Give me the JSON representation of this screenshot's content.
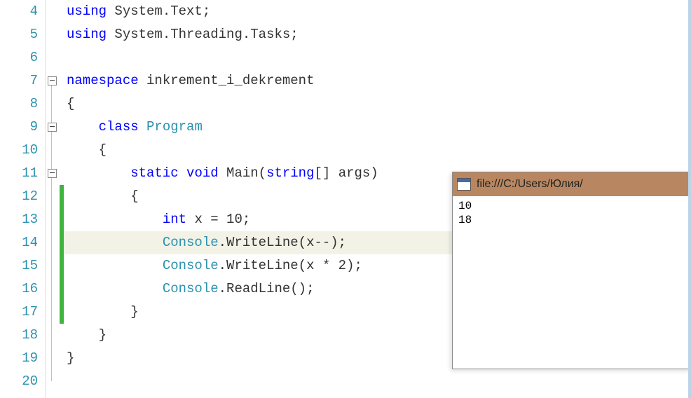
{
  "lines": [
    {
      "n": 4,
      "indent": "",
      "tokens": [
        [
          "kw",
          "using"
        ],
        [
          "txt",
          " System.Text;"
        ]
      ]
    },
    {
      "n": 5,
      "indent": "",
      "tokens": [
        [
          "kw",
          "using"
        ],
        [
          "txt",
          " System.Threading.Tasks;"
        ]
      ]
    },
    {
      "n": 6,
      "indent": "",
      "tokens": []
    },
    {
      "n": 7,
      "indent": "",
      "tokens": [
        [
          "kw",
          "namespace"
        ],
        [
          "txt",
          " inkrement_i_dekrement"
        ]
      ],
      "fold": true
    },
    {
      "n": 8,
      "indent": "",
      "tokens": [
        [
          "txt",
          "{"
        ]
      ]
    },
    {
      "n": 9,
      "indent": "    ",
      "tokens": [
        [
          "kw",
          "class"
        ],
        [
          "txt",
          " "
        ],
        [
          "type",
          "Program"
        ]
      ],
      "fold": true
    },
    {
      "n": 10,
      "indent": "    ",
      "tokens": [
        [
          "txt",
          "{"
        ]
      ]
    },
    {
      "n": 11,
      "indent": "        ",
      "tokens": [
        [
          "kw",
          "static"
        ],
        [
          "txt",
          " "
        ],
        [
          "kw",
          "void"
        ],
        [
          "txt",
          " Main("
        ],
        [
          "kw",
          "string"
        ],
        [
          "txt",
          "[] args)"
        ]
      ],
      "fold": true
    },
    {
      "n": 12,
      "indent": "        ",
      "tokens": [
        [
          "txt",
          "{"
        ]
      ],
      "changed": true
    },
    {
      "n": 13,
      "indent": "            ",
      "tokens": [
        [
          "kw",
          "int"
        ],
        [
          "txt",
          " x = 10;"
        ]
      ],
      "changed": true
    },
    {
      "n": 14,
      "indent": "            ",
      "tokens": [
        [
          "type",
          "Console"
        ],
        [
          "txt",
          ".WriteLine(x--);"
        ]
      ],
      "changed": true,
      "highlight": true
    },
    {
      "n": 15,
      "indent": "            ",
      "tokens": [
        [
          "type",
          "Console"
        ],
        [
          "txt",
          ".WriteLine(x * 2);"
        ]
      ],
      "changed": true
    },
    {
      "n": 16,
      "indent": "            ",
      "tokens": [
        [
          "type",
          "Console"
        ],
        [
          "txt",
          ".ReadLine();"
        ]
      ],
      "changed": true
    },
    {
      "n": 17,
      "indent": "        ",
      "tokens": [
        [
          "txt",
          "}"
        ]
      ],
      "changed": true
    },
    {
      "n": 18,
      "indent": "    ",
      "tokens": [
        [
          "txt",
          "}"
        ]
      ]
    },
    {
      "n": 19,
      "indent": "",
      "tokens": [
        [
          "txt",
          "}"
        ]
      ]
    },
    {
      "n": 20,
      "indent": "",
      "tokens": []
    }
  ],
  "console": {
    "title": "file:///C:/Users/Юлия/",
    "output": [
      "10",
      "18"
    ]
  }
}
